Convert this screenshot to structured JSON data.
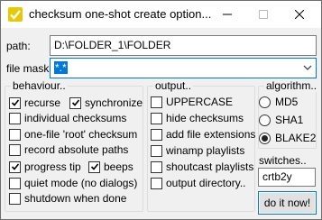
{
  "window": {
    "title": "checksum one-shot create option...",
    "controls": {
      "minimize_icon": "minimize-icon",
      "maximize_icon": "maximize-icon",
      "close_icon": "close-icon"
    }
  },
  "path": {
    "label": "path:",
    "value": "D:\\FOLDER_1\\FOLDER"
  },
  "file_mask": {
    "label": "file mask:",
    "value": "*.*"
  },
  "behaviour": {
    "title": "behaviour..",
    "options": {
      "recurse": {
        "label": "recurse",
        "checked": true
      },
      "synchronize": {
        "label": "synchronize",
        "checked": true
      },
      "individual_checksums": {
        "label": "individual checksums",
        "checked": false
      },
      "one_file_root": {
        "label": "one-file 'root' checksum",
        "checked": false
      },
      "record_absolute_paths": {
        "label": "record absolute paths",
        "checked": false
      },
      "progress_tip": {
        "label": "progress tip",
        "checked": true
      },
      "beeps": {
        "label": "beeps",
        "checked": true
      },
      "quiet_mode": {
        "label": "quiet mode (no dialogs)",
        "checked": false
      },
      "shutdown": {
        "label": "shutdown when done",
        "checked": false
      }
    }
  },
  "output": {
    "title": "output..",
    "options": {
      "uppercase": {
        "label": "UPPERCASE",
        "checked": false
      },
      "hide_checksums": {
        "label": "hide checksums",
        "checked": false
      },
      "add_file_extensions": {
        "label": "add file extensions",
        "checked": false
      },
      "winamp_playlists": {
        "label": "winamp playlists",
        "checked": false
      },
      "shoutcast_playlists": {
        "label": "shoutcast playlists",
        "checked": false
      },
      "output_directory": {
        "label": "output directory..",
        "checked": false
      }
    }
  },
  "algorithm": {
    "title": "algorithm..",
    "options": {
      "md5": {
        "label": "MD5",
        "selected": false
      },
      "sha1": {
        "label": "SHA1",
        "selected": false
      },
      "blake2": {
        "label": "BLAKE2",
        "selected": true
      }
    }
  },
  "switches": {
    "label": "switches..",
    "value": "crtb2y"
  },
  "go_button": {
    "label": "do it now!"
  },
  "colors": {
    "accent": "#0078d7",
    "window_bg": "#f0f0f0",
    "icon_yellow": "#e8c800"
  }
}
